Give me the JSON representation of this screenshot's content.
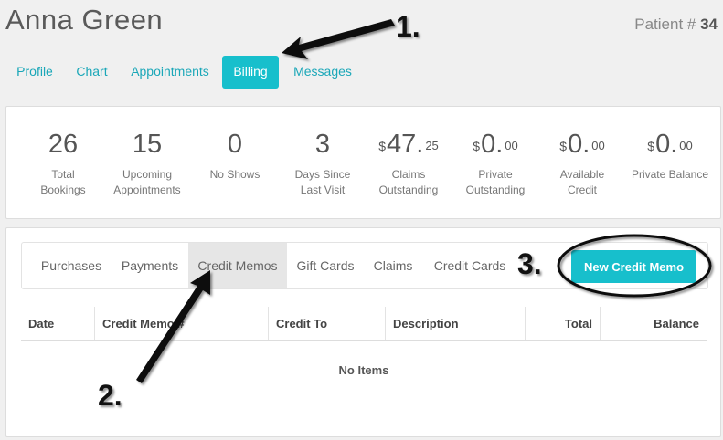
{
  "patient": {
    "name": "Anna Green",
    "id_prefix": "Patient # ",
    "id_number": "34"
  },
  "nav_tabs": [
    {
      "label": "Profile",
      "active": false
    },
    {
      "label": "Chart",
      "active": false
    },
    {
      "label": "Appointments",
      "active": false
    },
    {
      "label": "Billing",
      "active": true
    },
    {
      "label": "Messages",
      "active": false
    }
  ],
  "stats": [
    {
      "currency": "",
      "value": "26",
      "cents": "",
      "label": "Total\nBookings"
    },
    {
      "currency": "",
      "value": "15",
      "cents": "",
      "label": "Upcoming\nAppointments"
    },
    {
      "currency": "",
      "value": "0",
      "cents": "",
      "label": "No Shows"
    },
    {
      "currency": "",
      "value": "3",
      "cents": "",
      "label": "Days Since\nLast Visit"
    },
    {
      "currency": "$",
      "value": "47.",
      "cents": "25",
      "label": "Claims\nOutstanding"
    },
    {
      "currency": "$",
      "value": "0.",
      "cents": "00",
      "label": "Private\nOutstanding"
    },
    {
      "currency": "$",
      "value": "0.",
      "cents": "00",
      "label": "Available\nCredit"
    },
    {
      "currency": "$",
      "value": "0.",
      "cents": "00",
      "label": "Private Balance"
    }
  ],
  "billing_tabs": [
    {
      "label": "Purchases",
      "active": false
    },
    {
      "label": "Payments",
      "active": false
    },
    {
      "label": "Credit Memos",
      "active": true
    },
    {
      "label": "Gift Cards",
      "active": false
    },
    {
      "label": "Claims",
      "active": false
    },
    {
      "label": "Credit Cards",
      "active": false
    }
  ],
  "new_credit_memo_label": "New Credit Memo",
  "table": {
    "columns": [
      "Date",
      "Credit Memo #",
      "Credit To",
      "Description",
      "Total",
      "Balance"
    ],
    "empty_text": "No Items"
  },
  "annotations": [
    "1.",
    "2.",
    "3."
  ],
  "colors": {
    "accent": "#17bfcc",
    "link": "#1aa7b8",
    "background": "#f0f0f0"
  }
}
